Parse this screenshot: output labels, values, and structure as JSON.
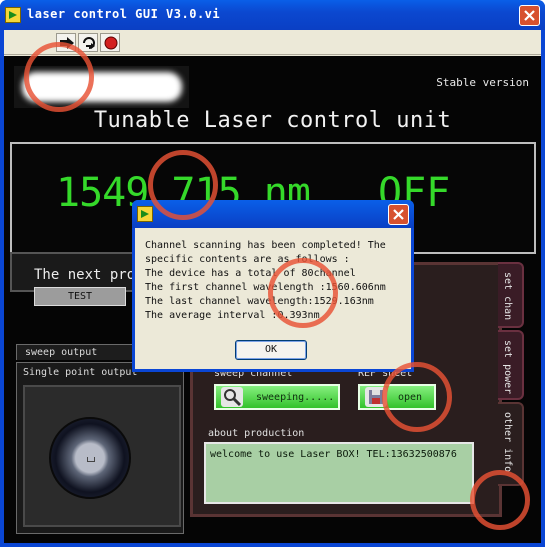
{
  "window": {
    "title": "laser control GUI V3.0.vi"
  },
  "toolbar": {
    "run": "run-arrow-icon",
    "run_cont": "run-continuously-icon",
    "abort": "abort-stop-icon"
  },
  "panel": {
    "stable_version": "Stable version",
    "heading": "Tunable Laser control unit",
    "wavelength": "1549.715 nm",
    "state": "OFF",
    "next_label": "The next pro",
    "test_button": "TEST",
    "sweep_output": "sweep output",
    "single_output": "Single point output",
    "sweep_channel_label": "sweep channel",
    "sweep_button": "sweeping.....",
    "ref_sheet_label": "REF sheet",
    "open_button": "open",
    "about_label": "about production",
    "about_text": "welcome to use Laser BOX! TEL:13632500876",
    "tabs": [
      "set chan",
      "set power",
      "other info"
    ]
  },
  "dialog": {
    "lines": [
      "Channel scanning has been completed! The",
      "specific contents are as follows :",
      "The device has a total of 80channel",
      "The first channel wavelength :1560.606nm",
      "The last channel wavelength:1529.163nm",
      "The average interval :0.393nm"
    ],
    "ok": "OK"
  },
  "colors": {
    "display_green": "#35d92a",
    "title_blue": "#0a46d4",
    "watermark": "#e85234"
  }
}
